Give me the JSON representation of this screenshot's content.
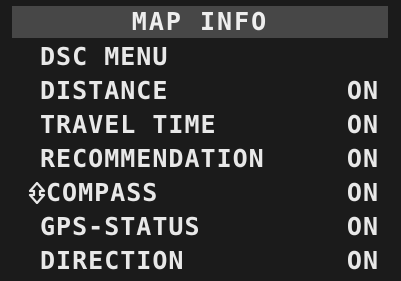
{
  "title": "MAP INFO",
  "items": [
    {
      "label": "DSC MENU",
      "value": "",
      "selected": false
    },
    {
      "label": "DISTANCE",
      "value": "ON",
      "selected": false
    },
    {
      "label": "TRAVEL TIME",
      "value": "ON",
      "selected": false
    },
    {
      "label": "RECOMMENDATION",
      "value": "ON",
      "selected": false
    },
    {
      "label": "COMPASS",
      "value": "ON",
      "selected": true
    },
    {
      "label": "GPS-STATUS",
      "value": "ON",
      "selected": false
    },
    {
      "label": "DIRECTION",
      "value": "ON",
      "selected": false
    }
  ],
  "icons": {
    "cursor": "selection-cursor-icon"
  },
  "colors": {
    "background": "#1b1b1b",
    "title_bar": "#474747",
    "text": "#e8e8e8"
  }
}
